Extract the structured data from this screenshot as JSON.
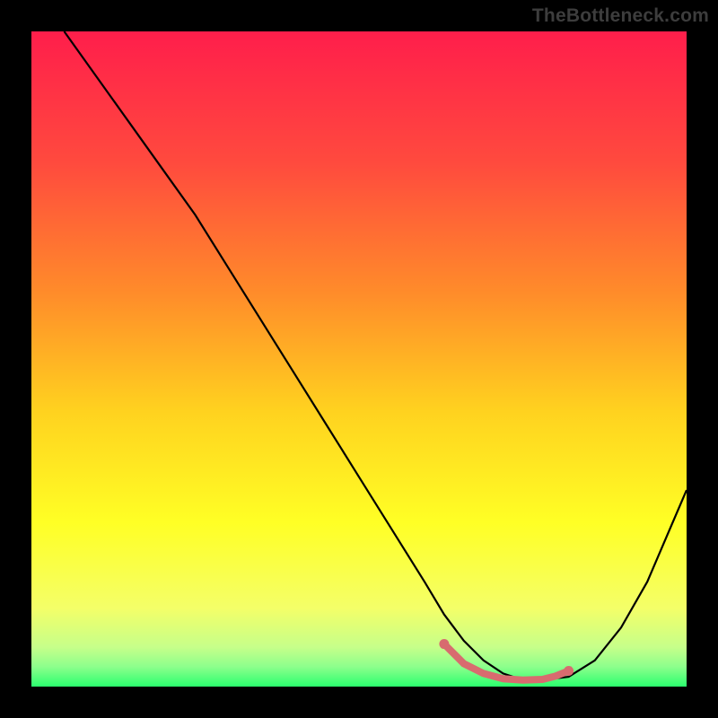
{
  "watermark": "TheBottleneck.com",
  "chart_data": {
    "type": "line",
    "title": "",
    "xlabel": "",
    "ylabel": "",
    "xlim": [
      0,
      100
    ],
    "ylim": [
      0,
      100
    ],
    "grid": false,
    "legend": false,
    "gradient_stops": [
      {
        "offset": 0.0,
        "color": "#ff1e4b"
      },
      {
        "offset": 0.2,
        "color": "#ff4a3e"
      },
      {
        "offset": 0.4,
        "color": "#ff8c2a"
      },
      {
        "offset": 0.58,
        "color": "#ffd21f"
      },
      {
        "offset": 0.75,
        "color": "#ffff25"
      },
      {
        "offset": 0.88,
        "color": "#f4ff68"
      },
      {
        "offset": 0.94,
        "color": "#c6ff8a"
      },
      {
        "offset": 0.97,
        "color": "#8cff8c"
      },
      {
        "offset": 1.0,
        "color": "#2bff6e"
      }
    ],
    "series": [
      {
        "name": "bottleneck-curve",
        "stroke": "#000000",
        "stroke_width": 2.2,
        "x": [
          5,
          10,
          15,
          20,
          25,
          30,
          35,
          40,
          45,
          50,
          55,
          60,
          63,
          66,
          69,
          72,
          75,
          78,
          82,
          86,
          90,
          94,
          97,
          100
        ],
        "y": [
          100,
          93,
          86,
          79,
          72,
          64,
          56,
          48,
          40,
          32,
          24,
          16,
          11,
          7,
          4,
          2,
          1,
          1,
          1.5,
          4,
          9,
          16,
          23,
          30
        ]
      }
    ],
    "highlight_segment": {
      "name": "valley-highlight",
      "stroke": "#d86b6f",
      "stroke_width": 8,
      "x": [
        63,
        66,
        69,
        72,
        75,
        78,
        80,
        82
      ],
      "y": [
        6.5,
        3.5,
        2.0,
        1.2,
        1.0,
        1.1,
        1.6,
        2.4
      ]
    },
    "highlight_endpoints": {
      "fill": "#d86b6f",
      "radius": 5.5,
      "points": [
        {
          "x": 63,
          "y": 6.5
        },
        {
          "x": 82,
          "y": 2.4
        }
      ]
    }
  }
}
